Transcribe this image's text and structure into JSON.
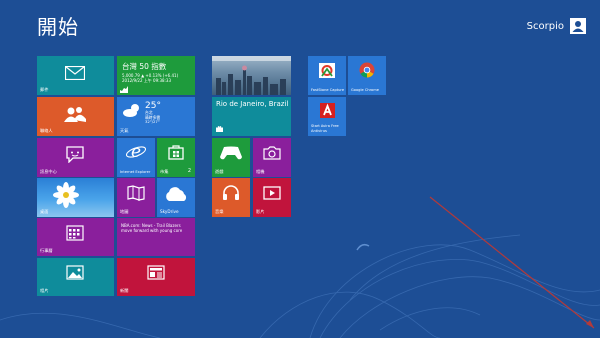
{
  "header": {
    "title": "開始",
    "user_name": "Scorpio"
  },
  "tiles": {
    "mail": {
      "label": "郵件"
    },
    "stocks": {
      "title": "台灣 50 指數",
      "line1": "5,000.79 ▲ +0.13% (+6.41)",
      "line2": "2012/9/22 上午 09:38:33"
    },
    "people": {
      "label": "聯絡人"
    },
    "weather": {
      "label": "天氣",
      "temp": "25°",
      "line1": "台北",
      "line2": "晴時多雲",
      "line3": "32°/27°"
    },
    "messaging": {
      "label": "訊息中心"
    },
    "ie": {
      "label": "Internet Explorer"
    },
    "store": {
      "label": "市集",
      "count": "2"
    },
    "photo_bg": {
      "label": "桌面"
    },
    "maps": {
      "label": "地圖"
    },
    "skydrive": {
      "label": "SkyDrive"
    },
    "calendar": {
      "label": "行事曆"
    },
    "news": {
      "text": "NBA.com: News - Trail Blazers move forward with young core"
    },
    "photos": {
      "label": "相片"
    },
    "newsapp": {
      "label": "新聞"
    },
    "travel": {
      "place": "Rio de Janeiro, Brazil"
    },
    "games": {
      "label": "遊戲"
    },
    "camera": {
      "label": "相機"
    },
    "music": {
      "label": "音樂"
    },
    "video": {
      "label": "影片"
    },
    "faststone": {
      "label": "FastStone Capture"
    },
    "chrome": {
      "label": "Google Chrome"
    },
    "avira": {
      "label": "Start Avira Free Antivirus"
    }
  },
  "colors": {
    "background": "#1d4e95",
    "green": "#1e9b3c",
    "orange": "#dd5a2a",
    "purple": "#8a1f9c",
    "blue_tile": "#2a77d4",
    "teal": "#0f8c9b",
    "red": "#c1143c"
  }
}
